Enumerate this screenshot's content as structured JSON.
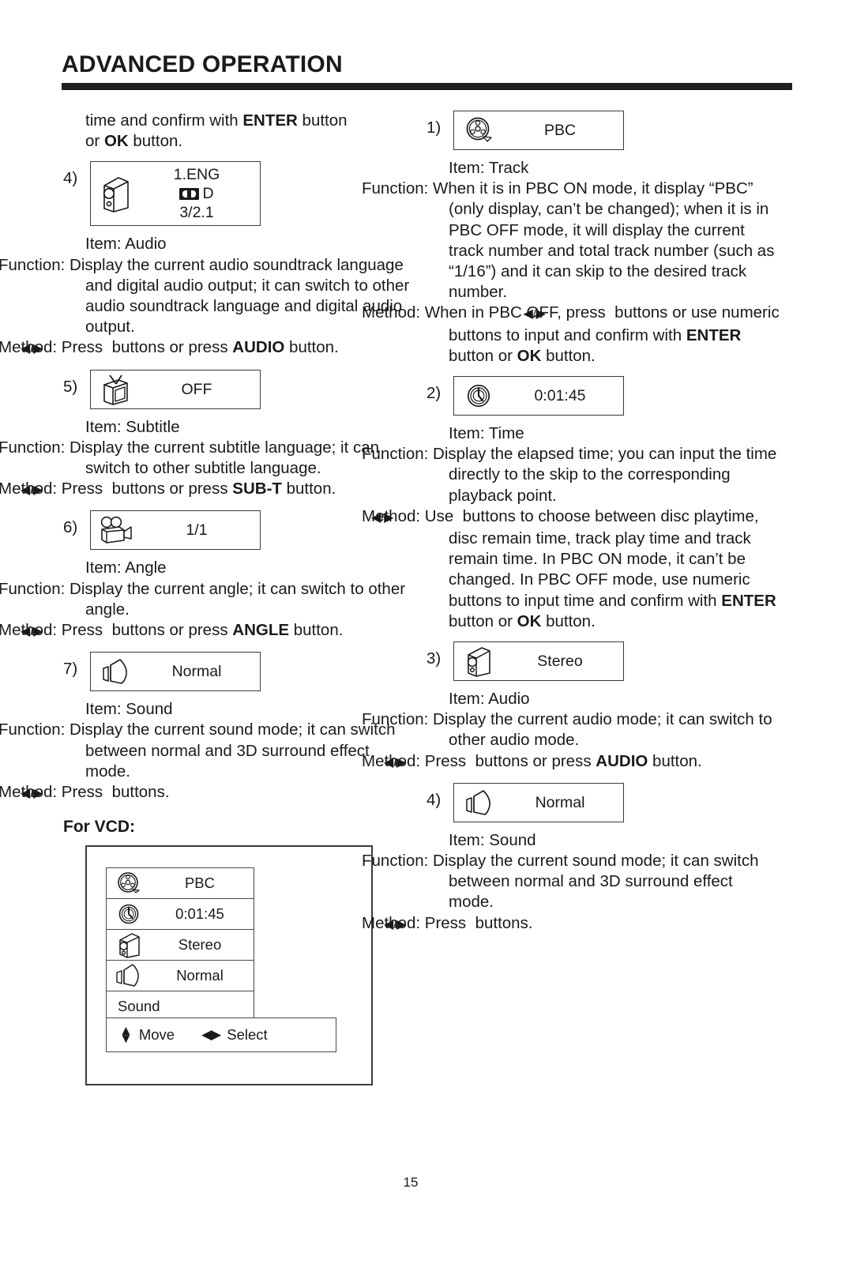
{
  "header": {
    "title": "ADVANCED OPERATION"
  },
  "page_number": "15",
  "left_column": {
    "intro": {
      "line1_a": "time and confirm with ",
      "line1_b": "ENTER",
      "line1_c": " button",
      "line2_a": "or ",
      "line2_b": "OK",
      "line2_c": " button."
    },
    "entries": [
      {
        "number": "4)",
        "osd": {
          "icon": "audio-speaker-icon",
          "lines": [
            "1.ENG",
            "D",
            "3/2.1"
          ],
          "has_dolby_glyph": true
        },
        "item_label": "Item: Audio",
        "function_label": "Function:",
        "function_text": "Display the current audio soundtrack language and digital audio output; it can switch to other audio soundtrack language and digital audio output.",
        "method_label": "Method:",
        "method_pre": "Press ",
        "method_mid": " buttons or press ",
        "method_bold": "AUDIO",
        "method_post": " button."
      },
      {
        "number": "5)",
        "osd": {
          "icon": "tv-subtitle-icon",
          "lines": [
            "OFF"
          ],
          "has_dolby_glyph": false
        },
        "item_label": "Item: Subtitle",
        "function_label": "Function:",
        "function_text": "Display the current subtitle language; it can switch to other subtitle language.",
        "method_label": "Method:",
        "method_pre": "Press ",
        "method_mid": " buttons or press ",
        "method_bold": "SUB-T",
        "method_post": " button."
      },
      {
        "number": "6)",
        "osd": {
          "icon": "movie-camera-angle-icon",
          "lines": [
            "1/1"
          ],
          "has_dolby_glyph": false
        },
        "item_label": "Item: Angle",
        "function_label": "Function:",
        "function_text": "Display the current angle; it can switch to other angle.",
        "method_label": "Method:",
        "method_pre": "Press ",
        "method_mid": " buttons or press ",
        "method_bold": "ANGLE",
        "method_post": " button."
      },
      {
        "number": "7)",
        "osd": {
          "icon": "sound-speaker-icon",
          "lines": [
            "Normal"
          ],
          "has_dolby_glyph": false
        },
        "item_label": "Item: Sound",
        "function_label": "Function:",
        "function_text": "Display the current sound mode; it can switch between normal and 3D surround effect mode.",
        "method_label": "Method:",
        "method_pre": "Press ",
        "method_mid": " buttons.",
        "method_bold": "",
        "method_post": ""
      }
    ],
    "for_vcd_heading": "For VCD:",
    "vcd_diagram": {
      "items": [
        {
          "icon": "film-reel-icon",
          "label": "PBC"
        },
        {
          "icon": "clock-time-icon",
          "label": "0:01:45"
        },
        {
          "icon": "audio-speaker-icon",
          "label": "Stereo"
        },
        {
          "icon": "sound-speaker-icon",
          "label": "Normal"
        },
        {
          "icon": "",
          "label": "Sound"
        }
      ],
      "footer": {
        "move_label": "Move",
        "select_label": "Select"
      }
    }
  },
  "right_column": {
    "entries": [
      {
        "number": "1)",
        "osd": {
          "icon": "film-reel-icon",
          "lines": [
            "PBC"
          ]
        },
        "item_label": "Item: Track",
        "function_label": "Function:",
        "function_text": "When it is in PBC ON mode, it display “PBC” (only display, can’t be changed); when it is in PBC OFF mode, it will display the current track number and total track number (such as “1/16”) and it can skip to the desired track number.",
        "method_label": "Method:",
        "method_pre": "When in PBC OFF, press ",
        "method_mid": " buttons or use numeric buttons to input and confirm with ",
        "method_bold": "ENTER",
        "method_mid2": " button or ",
        "method_bold2": "OK",
        "method_post": " button."
      },
      {
        "number": "2)",
        "osd": {
          "icon": "clock-time-icon",
          "lines": [
            "0:01:45"
          ]
        },
        "item_label": "Item: Time",
        "function_label": "Function:",
        "function_text": "Display the elapsed time; you can input the time directly to the skip to the corresponding playback point.",
        "method_label": "Method:",
        "method_pre": "Use ",
        "method_mid": " buttons to choose between disc playtime, disc remain time, track play time and track remain time.  In PBC ON mode, it can’t be changed. In PBC OFF mode, use numeric buttons to input time and confirm with ",
        "method_bold": "ENTER",
        "method_mid2": " button or ",
        "method_bold2": "OK",
        "method_post": " button."
      },
      {
        "number": "3)",
        "osd": {
          "icon": "audio-speaker-icon",
          "lines": [
            "Stereo"
          ]
        },
        "item_label": "Item: Audio",
        "function_label": "Function:",
        "function_text": "Display the current audio mode; it can switch to other audio mode.",
        "method_label": "Method:",
        "method_pre": "Press ",
        "method_mid": " buttons or press ",
        "method_bold": "AUDIO",
        "method_mid2": "",
        "method_bold2": "",
        "method_post": " button."
      },
      {
        "number": "4)",
        "osd": {
          "icon": "sound-speaker-icon",
          "lines": [
            "Normal"
          ]
        },
        "item_label": "Item: Sound",
        "function_label": "Function:",
        "function_text": "Display the current sound mode; it can switch between normal and 3D surround effect mode.",
        "method_label": "Method:",
        "method_pre": "Press ",
        "method_mid": " buttons.",
        "method_bold": "",
        "method_mid2": "",
        "method_bold2": "",
        "method_post": ""
      }
    ]
  },
  "glyphs": {
    "left_arrow": "◀",
    "right_arrow": "▶",
    "slash": "/",
    "up_arrow": "▲",
    "down_arrow": "▼"
  }
}
